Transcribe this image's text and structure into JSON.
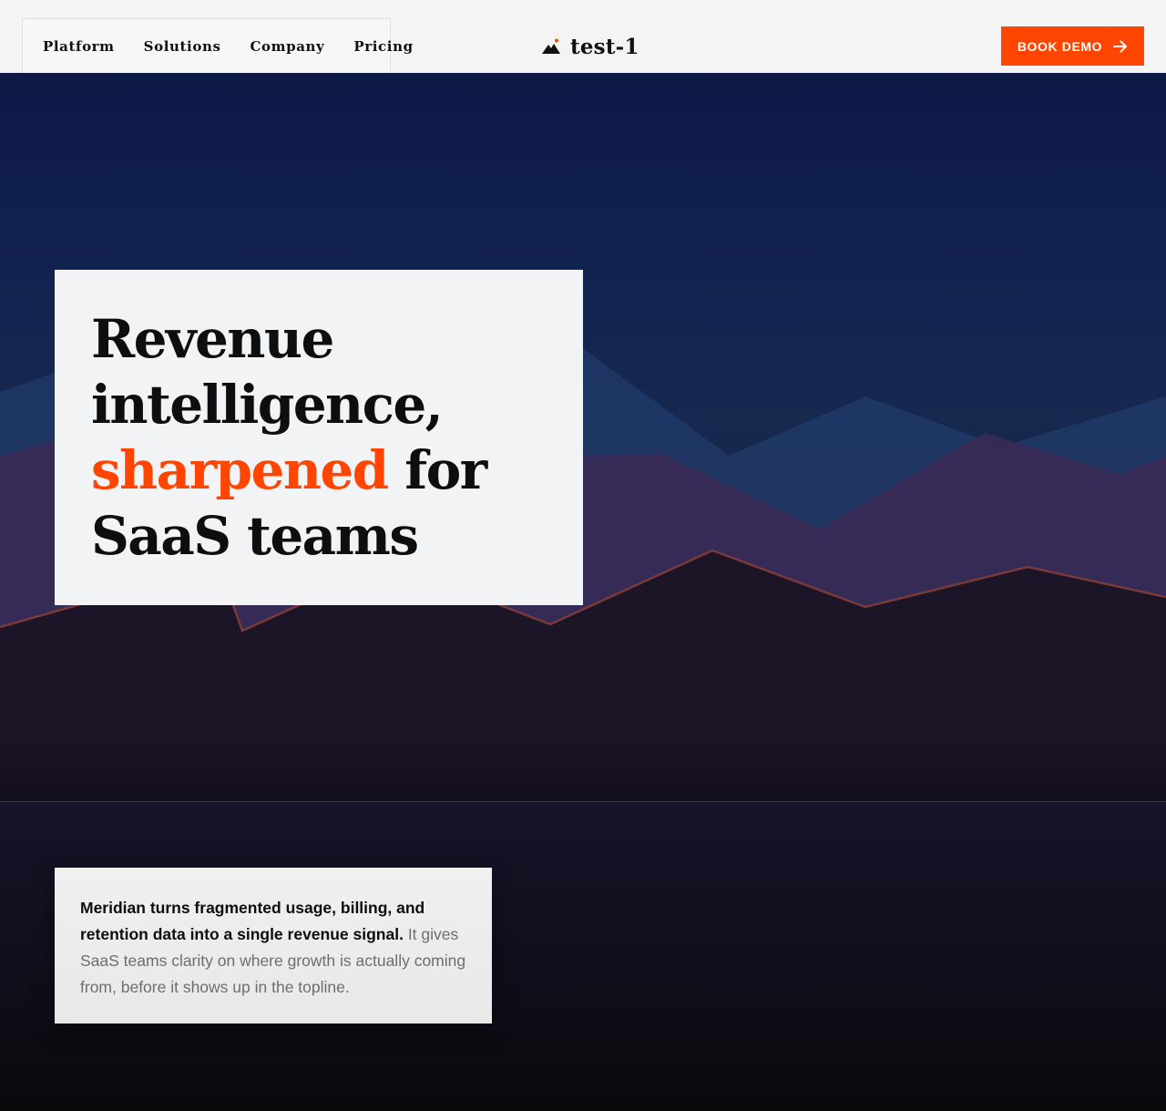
{
  "header": {
    "nav": [
      {
        "label": "Platform"
      },
      {
        "label": "Solutions"
      },
      {
        "label": "Company"
      },
      {
        "label": "Pricing"
      }
    ],
    "logo_text": "test-1",
    "cta_label": "BOOK DEMO"
  },
  "hero": {
    "title_line1": "Revenue",
    "title_line2": "intelligence,",
    "title_accent": "sharpened",
    "title_after_accent": " for",
    "title_line4": "SaaS teams"
  },
  "description": {
    "strong": "Meridian turns fragmented usage, billing, and retention data into a single revenue signal.",
    "rest": " It gives SaaS teams clarity on where growth is actually coming from, before it shows up in the topline."
  },
  "colors": {
    "accent": "#ff4500",
    "header_bg": "#f4f4f4",
    "hero_card_bg": "#f2f3f5",
    "text_dark": "#0e0e0e"
  },
  "icons": {
    "logo": "mountain-icon",
    "cta": "arrow-right-icon"
  }
}
